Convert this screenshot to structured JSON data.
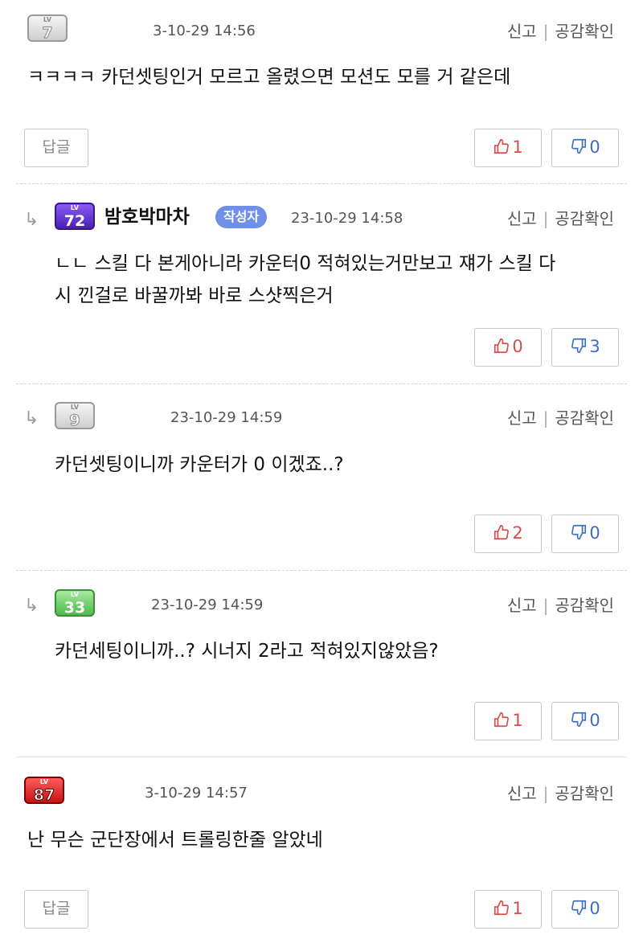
{
  "comments": [
    {
      "level": "7",
      "badge": "gray",
      "author": "",
      "writer_tag": "",
      "date": "3-10-29 14:56",
      "report": "신고",
      "sympathy": "공감확인",
      "text_lines": [
        "ㅋㅋㅋㅋ 카던셋팅인거 모르고 올렸으면 모션도 모를 거 같은데"
      ],
      "reply_label": "답글",
      "upvotes": "1",
      "downvotes": "0"
    },
    {
      "level": "72",
      "badge": "purple",
      "author": "밤호박마차",
      "writer_tag": "작성자",
      "date": "23-10-29 14:58",
      "report": "신고",
      "sympathy": "공감확인",
      "text_lines": [
        "ㄴㄴ 스킬 다 본게아니라 카운터0 적혀있는거만보고 쟤가 스킬 다",
        "시 낀걸로 바꿀까봐 바로 스샷찍은거"
      ],
      "reply_label": "",
      "upvotes": "0",
      "downvotes": "3"
    },
    {
      "level": "9",
      "badge": "gray",
      "author": "",
      "writer_tag": "",
      "date": "23-10-29 14:59",
      "report": "신고",
      "sympathy": "공감확인",
      "text_lines": [
        "카던셋팅이니까 카운터가 0 이겠죠..?"
      ],
      "reply_label": "",
      "upvotes": "2",
      "downvotes": "0"
    },
    {
      "level": "33",
      "badge": "green",
      "author": "",
      "writer_tag": "",
      "date": "23-10-29 14:59",
      "report": "신고",
      "sympathy": "공감확인",
      "text_lines": [
        "카던세팅이니까..? 시너지 2라고 적혀있지않았음?"
      ],
      "reply_label": "",
      "upvotes": "1",
      "downvotes": "0"
    },
    {
      "level": "87",
      "badge": "red",
      "author": "",
      "writer_tag": "",
      "date": "3-10-29 14:57",
      "report": "신고",
      "sympathy": "공감확인",
      "text_lines": [
        "난 무슨 군단장에서 트롤링한줄 알았네"
      ],
      "reply_label": "답글",
      "upvotes": "1",
      "downvotes": "0"
    }
  ],
  "badge_lv_text": "LV",
  "reply_arrow": "↳",
  "colors": {
    "up": "#d84c4c",
    "down": "#3a6fc8",
    "writer_tag": "#6f8fe8"
  }
}
